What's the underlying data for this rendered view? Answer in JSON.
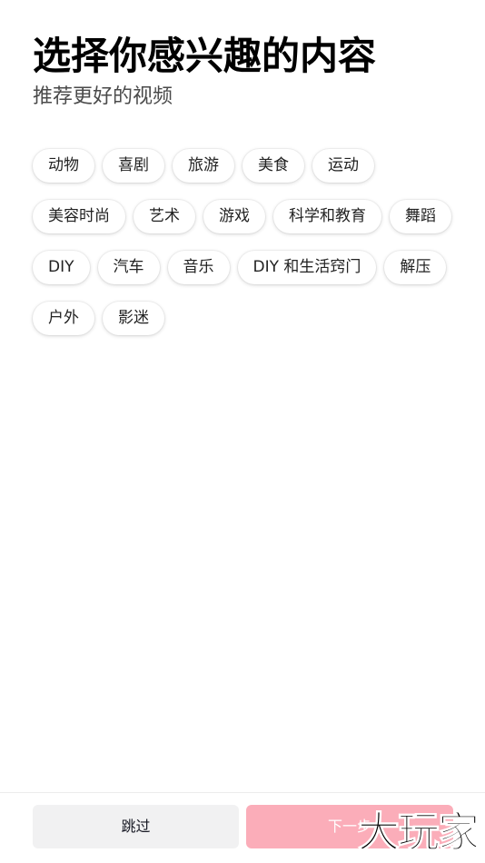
{
  "header": {
    "title": "选择你感兴趣的内容",
    "subtitle": "推荐更好的视频"
  },
  "tag_rows": [
    [
      "动物",
      "喜剧",
      "旅游",
      "美食",
      "运动"
    ],
    [
      "美容时尚",
      "艺术",
      "游戏",
      "科学和教育",
      "舞蹈"
    ],
    [
      "DIY",
      "汽车",
      "音乐",
      "DIY 和生活窍门",
      "解压"
    ],
    [
      "户外",
      "影迷"
    ]
  ],
  "footer": {
    "skip_label": "跳过",
    "next_label": "下一步"
  },
  "watermark": "大玩家",
  "colors": {
    "primary_disabled": "#fbadb9",
    "secondary_bg": "#f1f1f2"
  }
}
